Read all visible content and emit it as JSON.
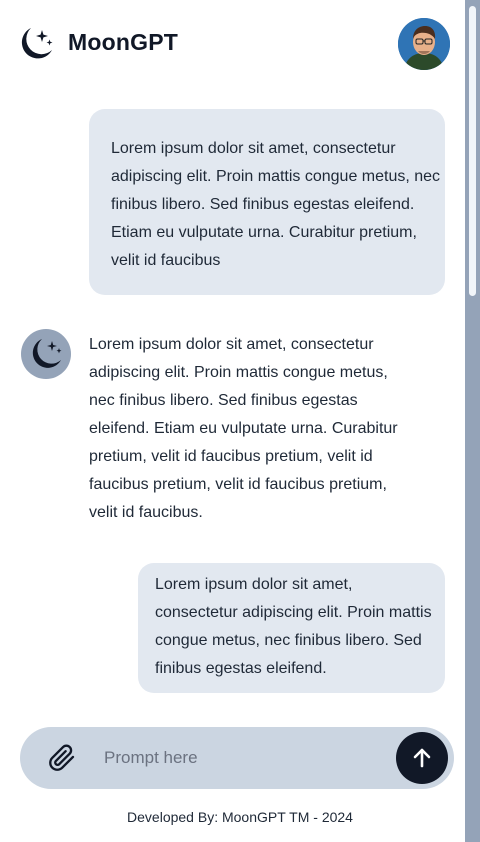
{
  "header": {
    "title": "MoonGPT",
    "logo_icon": "moon-stars-icon",
    "avatar_icon": "user-avatar"
  },
  "messages": [
    {
      "role": "user",
      "text": "Lorem ipsum dolor sit amet, consectetur adipiscing elit. Proin mattis congue metus, nec finibus libero. Sed finibus egestas eleifend. Etiam eu vulputate urna. Curabitur pretium, velit id faucibus"
    },
    {
      "role": "assistant",
      "text": "Lorem ipsum dolor sit amet, consectetur adipiscing elit. Proin mattis congue metus, nec finibus libero. Sed finibus egestas eleifend. Etiam eu vulputate urna. Curabitur pretium, velit id faucibus pretium, velit id faucibus pretium, velit id faucibus pretium, velit id faucibus."
    },
    {
      "role": "user",
      "text": "Lorem ipsum dolor sit amet, consectetur adipiscing elit. Proin mattis congue metus, nec finibus libero. Sed finibus egestas eleifend."
    }
  ],
  "prompt": {
    "placeholder": "Prompt here",
    "value": "",
    "attach_icon": "paperclip-icon",
    "send_icon": "arrow-up-icon"
  },
  "footer": {
    "text": "Developed By: MoonGPT TM - 2024"
  },
  "colors": {
    "user_bubble": "#e2e8f0",
    "prompt_bar": "#cbd5e1",
    "send_button": "#111827",
    "scrollbar": "#94a3b8"
  }
}
